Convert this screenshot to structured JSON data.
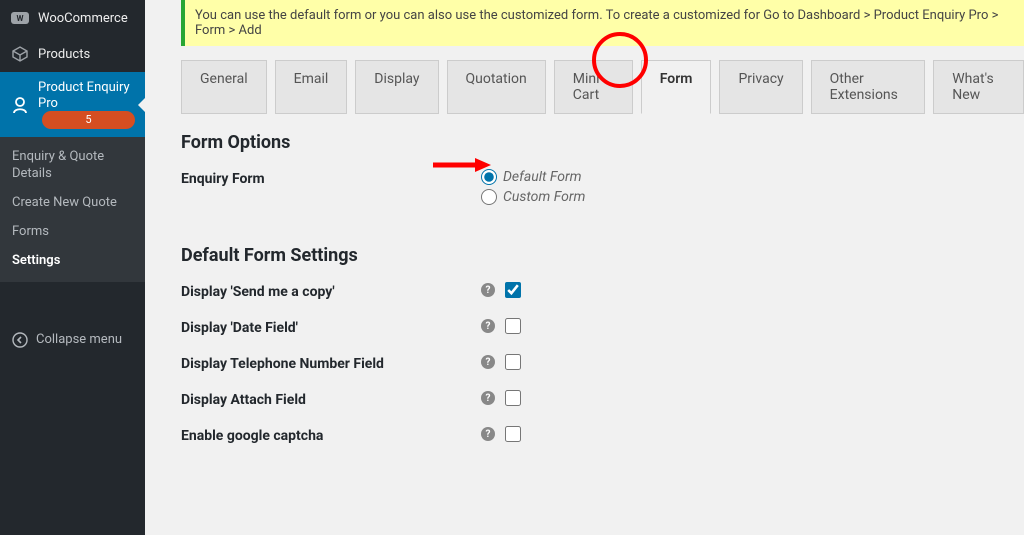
{
  "sidebar": {
    "items": [
      {
        "label": "WooCommerce",
        "icon": "woocommerce"
      },
      {
        "label": "Products",
        "icon": "product"
      }
    ],
    "active": {
      "label": "Product Enquiry Pro",
      "badge": "5"
    },
    "sub": [
      {
        "label": "Enquiry & Quote Details"
      },
      {
        "label": "Create New Quote"
      },
      {
        "label": "Forms"
      },
      {
        "label": "Settings",
        "highlight": true
      }
    ],
    "collapse": "Collapse menu"
  },
  "notice": "You can use the default form or you can also use the customized form. To create a customized for Go to Dashboard > Product Enquiry Pro > Form > Add ",
  "tabs": [
    "General",
    "Email",
    "Display",
    "Quotation",
    "Mini Cart",
    "Form",
    "Privacy",
    "Other Extensions",
    "What's New"
  ],
  "active_tab_index": 5,
  "sections": {
    "form_options": "Form Options",
    "default_form_settings": "Default Form Settings"
  },
  "fields": {
    "enquiry_form": {
      "label": "Enquiry Form",
      "options": [
        "Default Form",
        "Custom Form"
      ],
      "selected": 0
    },
    "send_copy": {
      "label": "Display 'Send me a copy'",
      "checked": true
    },
    "date_field": {
      "label": "Display 'Date Field'",
      "checked": false
    },
    "telephone": {
      "label": "Display Telephone Number Field",
      "checked": false
    },
    "attach": {
      "label": "Display Attach Field",
      "checked": false
    },
    "captcha": {
      "label": "Enable google captcha",
      "checked": false
    }
  }
}
